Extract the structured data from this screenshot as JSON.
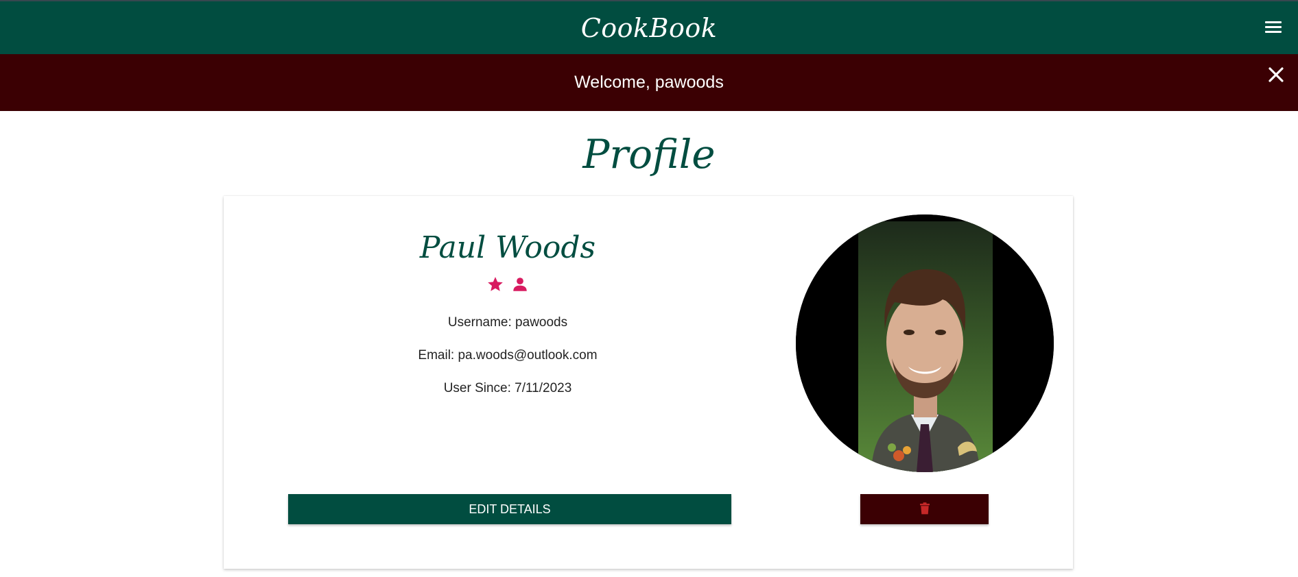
{
  "navbar": {
    "brand": "CookBook",
    "menu_icon": "menu-icon",
    "background": "#014d40"
  },
  "flash": {
    "message": "Welcome, pawoods",
    "close_icon": "close-icon",
    "background": "#3b0003"
  },
  "page": {
    "title": "Profile"
  },
  "profile": {
    "full_name": "Paul Woods",
    "role_icons": [
      "star-icon",
      "person-icon"
    ],
    "accent_color": "#d81b60",
    "username_line": "Username: pawoods",
    "email_line": "Email: pa.woods@outlook.com",
    "user_since_line": "User Since: 7/11/2023",
    "avatar_alt": "Profile photo of Paul Woods"
  },
  "actions": {
    "edit_label": "EDIT DETAILS",
    "delete_icon": "trash-icon",
    "delete_color": "#c62828"
  }
}
